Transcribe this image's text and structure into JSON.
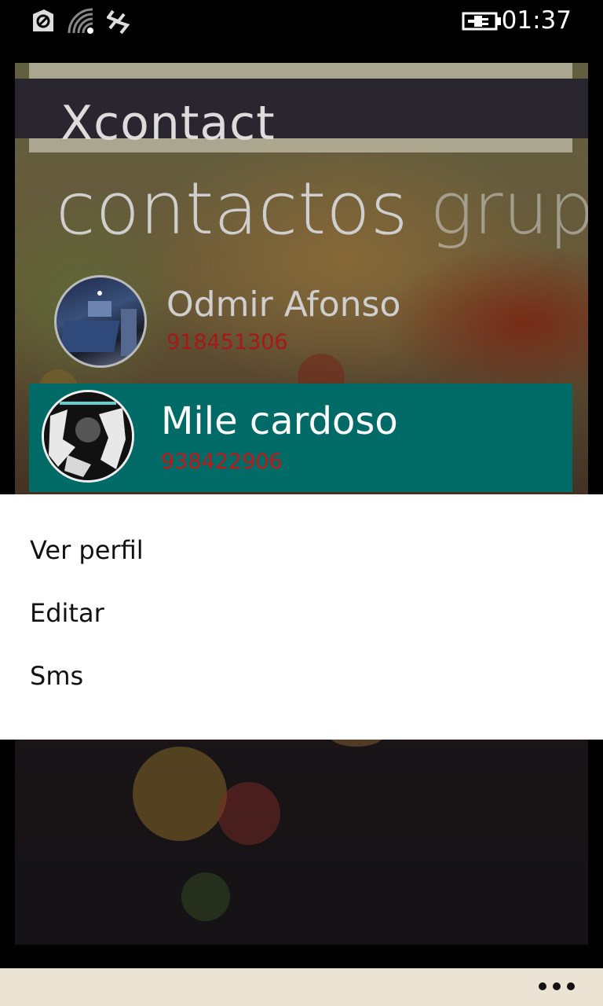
{
  "status_bar": {
    "time": "01:37",
    "icons": [
      "data-sense-icon",
      "wifi-icon",
      "vibrate-icon",
      "battery-charging-icon"
    ]
  },
  "app": {
    "title": "Xcontact",
    "pivots": [
      {
        "label": "contactos",
        "active": true
      },
      {
        "label": "grup",
        "active": false
      }
    ],
    "contacts": [
      {
        "name": "Odmir Afonso",
        "phone": "918451306"
      },
      {
        "name": "Mile cardoso",
        "phone": "938422906",
        "selected": true
      }
    ]
  },
  "context_menu": {
    "items": [
      "Ver perfil",
      "Editar",
      "Sms"
    ]
  },
  "app_bar": {
    "more_icon": "ellipsis-icon"
  },
  "colors": {
    "selected_row": "#006a66",
    "phone_text": "#c01818",
    "app_bar": "#ebe3d3"
  }
}
